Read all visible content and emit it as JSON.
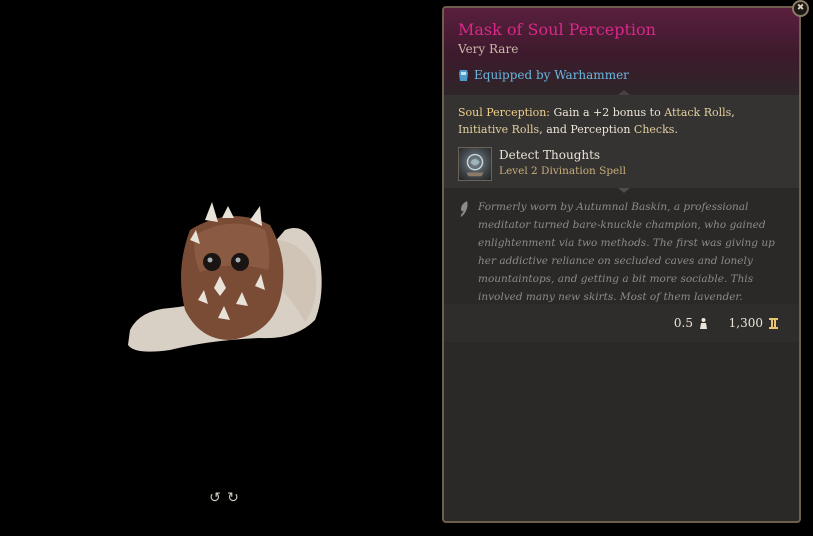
{
  "item": {
    "title": "Mask of Soul Perception",
    "rarity": "Very Rare",
    "equipped": "Equipped by Warhammer"
  },
  "passive": {
    "name": "Soul Perception:",
    "text_1": "Gain a +2 bonus to",
    "attack": "Attack Rolls",
    "sep_1": ",",
    "initiative": "Initiative Rolls",
    "sep_2": ",",
    "text_2": "and Perception",
    "checks": "Checks",
    "end": "."
  },
  "spell": {
    "name": "Detect Thoughts",
    "level": "Level 2 Divination Spell",
    "icon": "detect-thoughts-icon"
  },
  "lore": "Formerly worn by Autumnal Baskin, a professional meditator turned bare-knuckle champion, who gained enlightenment via two methods. The first was giving up her addictive reliance on secluded caves and lonely mountaintops, and getting a bit more sociable. This involved many new skirts. Most of them lavender.",
  "footer": {
    "weight": "0.5",
    "price": "1,300"
  },
  "controls": {
    "rotate_left": "↺",
    "rotate_right": "↻",
    "close": "✖"
  },
  "colors": {
    "title": "#d8288a",
    "equipped": "#6ab6df",
    "keyword": "#e2cf9e"
  }
}
